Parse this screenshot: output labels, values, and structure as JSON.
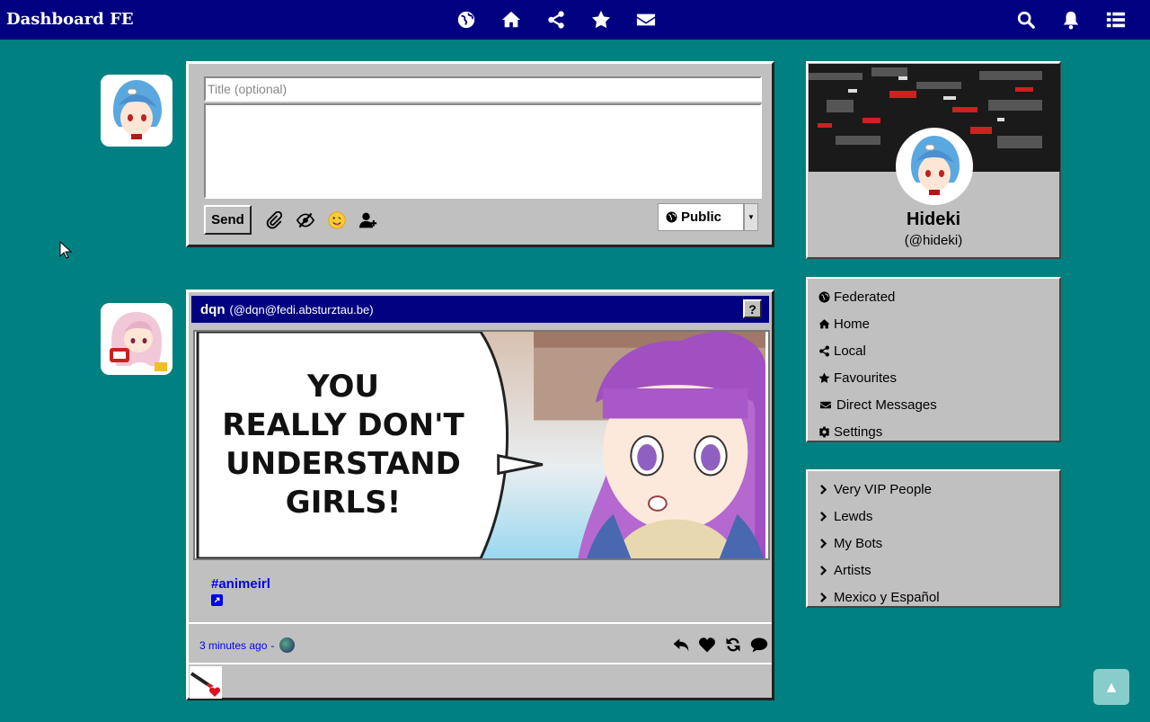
{
  "app": {
    "title": "Dashboard FE"
  },
  "nav": {
    "center": [
      "globe-icon",
      "home-icon",
      "share-icon",
      "star-icon",
      "envelope-icon"
    ],
    "right": [
      "search-icon",
      "bell-icon",
      "list-icon"
    ]
  },
  "compose": {
    "title_placeholder": "Title (optional)",
    "send_label": "Send",
    "tools": [
      "paperclip-icon",
      "eye-slash-icon",
      "emoji-icon",
      "user-plus-icon"
    ],
    "visibility": "Public"
  },
  "post": {
    "author_name": "dqn",
    "author_handle": "(@dqn@fedi.absturztau.be)",
    "help": "?",
    "image_text": [
      "YOU",
      "REALLY DON'T",
      "UNDERSTAND",
      "GIRLS!"
    ],
    "hashtag": "#animeirl",
    "time": "3 minutes ago",
    "separator": "-",
    "actions": [
      "reply-icon",
      "heart-icon",
      "repeat-icon",
      "comment-icon"
    ]
  },
  "profile": {
    "name": "Hideki",
    "handle": "(@hideki)"
  },
  "menu_main": [
    {
      "icon": "globe-icon",
      "label": "Federated"
    },
    {
      "icon": "home-icon",
      "label": "Home"
    },
    {
      "icon": "share-icon",
      "label": "Local"
    },
    {
      "icon": "star-icon",
      "label": "Favourites"
    },
    {
      "icon": "envelope-icon",
      "label": "Direct Messages"
    },
    {
      "icon": "gear-icon",
      "label": "Settings"
    }
  ],
  "menu_lists": [
    {
      "icon": "chevron-right-icon",
      "label": "Very VIP People"
    },
    {
      "icon": "chevron-right-icon",
      "label": "Lewds"
    },
    {
      "icon": "chevron-right-icon",
      "label": "My Bots"
    },
    {
      "icon": "chevron-right-icon",
      "label": "Artists"
    },
    {
      "icon": "chevron-right-icon",
      "label": "Mexico y Español"
    }
  ],
  "colors": {
    "background": "#008080",
    "navbar": "#000080",
    "panel": "#c0c0c0",
    "link": "#0000ee"
  }
}
